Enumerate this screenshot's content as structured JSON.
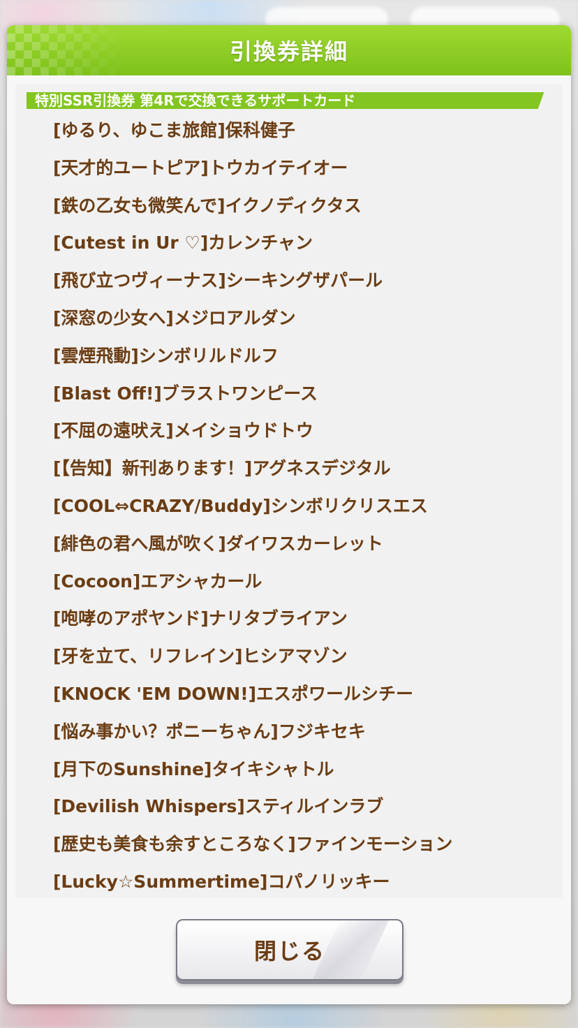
{
  "dialog": {
    "title": "引換券詳細",
    "section_title": "特別SSR引換券 第4Rで交換できるサポートカード",
    "cards": [
      "[ゆるり、ゆこま旅館]保科健子",
      "[天才的ユートピア]トウカイテイオー",
      "[鉄の乙女も微笑んで]イクノディクタス",
      "[Cutest in Ur ♡]カレンチャン",
      "[飛び立つヴィーナス]シーキングザパール",
      "[深窓の少女へ]メジロアルダン",
      "[雲煙飛動]シンボリルドルフ",
      "[Blast Off!]ブラストワンピース",
      "[不屈の遠吠え]メイショウドトウ",
      "[【告知】新刊あります！]アグネスデジタル",
      "[COOL⇔CRAZY/Buddy]シンボリクリスエス",
      "[緋色の君へ風が吹く]ダイワスカーレット",
      "[Cocoon]エアシャカール",
      "[咆哮のアポヤンド]ナリタブライアン",
      "[牙を立て、リフレイン]ヒシアマゾン",
      "[KNOCK 'EM DOWN!]エスポワールシチー",
      "[悩み事かい？ポニーちゃん]フジキセキ",
      "[月下のSunshine]タイキシャトル",
      "[Devilish Whispers]スティルインラブ",
      "[歴史も美食も余すところなく]ファインモーション",
      "[Lucky☆Summertime]コパノリッキー"
    ],
    "close_label": "閉じる"
  },
  "colors": {
    "header_green": "#8ccf25",
    "text_brown": "#6b3d14"
  }
}
